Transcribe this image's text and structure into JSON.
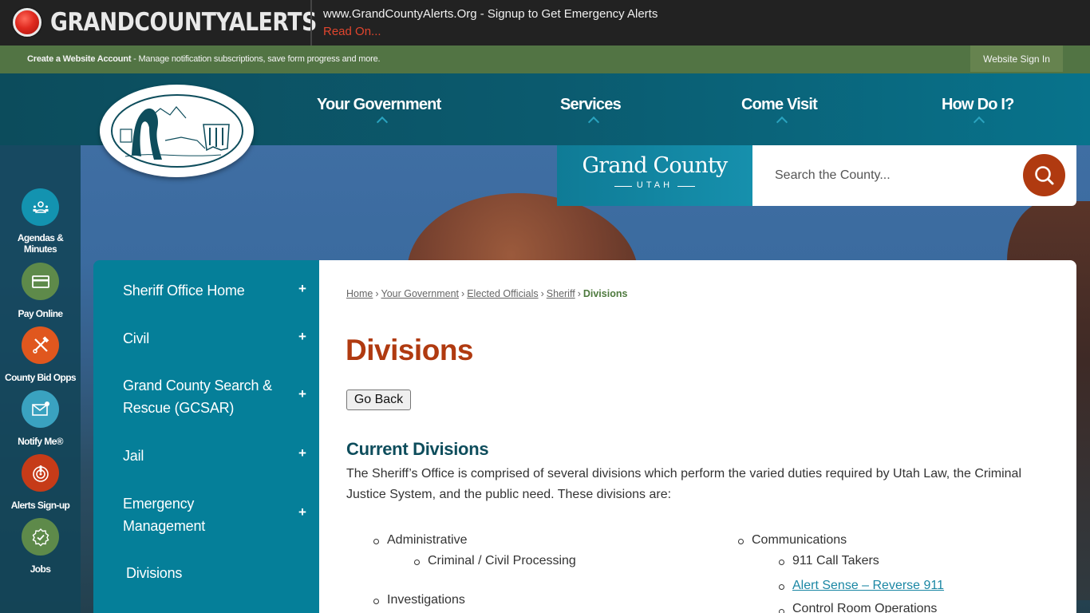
{
  "alert_bar": {
    "brand": "GRANDCOUNTYALERTS",
    "message": "www.GrandCountyAlerts.Org - Signup to Get Emergency Alerts",
    "read_on": "Read On..."
  },
  "account_bar": {
    "create_label": "Create a Website Account",
    "description": " - Manage notification subscriptions, save form progress and more.",
    "sign_in": "Website Sign In"
  },
  "main_nav": {
    "items": [
      {
        "label": "Your Government"
      },
      {
        "label": "Services"
      },
      {
        "label": "Come Visit"
      },
      {
        "label": "How Do I?"
      }
    ]
  },
  "brand": {
    "name": "Grand County",
    "state": "UTAH"
  },
  "search": {
    "placeholder": "Search the County..."
  },
  "quick_links": [
    {
      "label_line1": "Agendas &",
      "label_line2": "Minutes",
      "icon": "people-icon",
      "color": "#1393b0"
    },
    {
      "label_line1": "Pay Online",
      "label_line2": "",
      "icon": "credit-card-icon",
      "color": "#5e8a4a"
    },
    {
      "label_line1": "County Bid Opps",
      "label_line2": "",
      "icon": "tools-icon",
      "color": "#e0571e"
    },
    {
      "label_line1": "Notify Me®",
      "label_line2": "",
      "icon": "envelope-icon",
      "color": "#3aa2c0"
    },
    {
      "label_line1": "Alerts Sign-up",
      "label_line2": "",
      "icon": "alert-icon",
      "color": "#c63b18"
    },
    {
      "label_line1": "Jobs",
      "label_line2": "",
      "icon": "badge-check-icon",
      "color": "#5e8a4a"
    }
  ],
  "subnav": {
    "items": [
      {
        "label_line1": "Sheriff Office Home",
        "label_line2": "",
        "expandable": "+"
      },
      {
        "label_line1": "Civil",
        "label_line2": "",
        "expandable": "+"
      },
      {
        "label_line1": "Grand County Search &",
        "label_line2": "Rescue (GCSAR)",
        "expandable": "+"
      },
      {
        "label_line1": "Jail",
        "label_line2": "",
        "expandable": "+"
      },
      {
        "label_line1": "Emergency",
        "label_line2": "Management",
        "expandable": "+"
      },
      {
        "label_line1": "Divisions",
        "label_line2": "",
        "expandable": ""
      }
    ]
  },
  "breadcrumb": {
    "items": [
      "Home",
      "Your Government",
      "Elected Officials",
      "Sheriff"
    ],
    "current": "Divisions",
    "separator": "›"
  },
  "page": {
    "title": "Divisions",
    "go_back": "Go Back",
    "section_title": "Current Divisions",
    "intro": "The Sheriff’s Office is comprised of several divisions which perform the varied duties required by Utah Law, the Criminal Justice System, and the public need. These divisions are:"
  },
  "divisions": {
    "left": [
      {
        "name": "Administrative",
        "children": [
          "Criminal / Civil Processing"
        ]
      },
      {
        "name": "Investigations",
        "children": []
      }
    ],
    "right": [
      {
        "name": "Communications",
        "children": [
          "911 Call Takers",
          "Alert Sense – Reverse 911",
          "Control Room Operations"
        ]
      }
    ],
    "linked_child": "Alert Sense – Reverse 911"
  },
  "colors": {
    "accent_orange": "#b03a10",
    "teal": "#057f99",
    "green": "#527444",
    "heading_teal": "#0e4d5c"
  }
}
